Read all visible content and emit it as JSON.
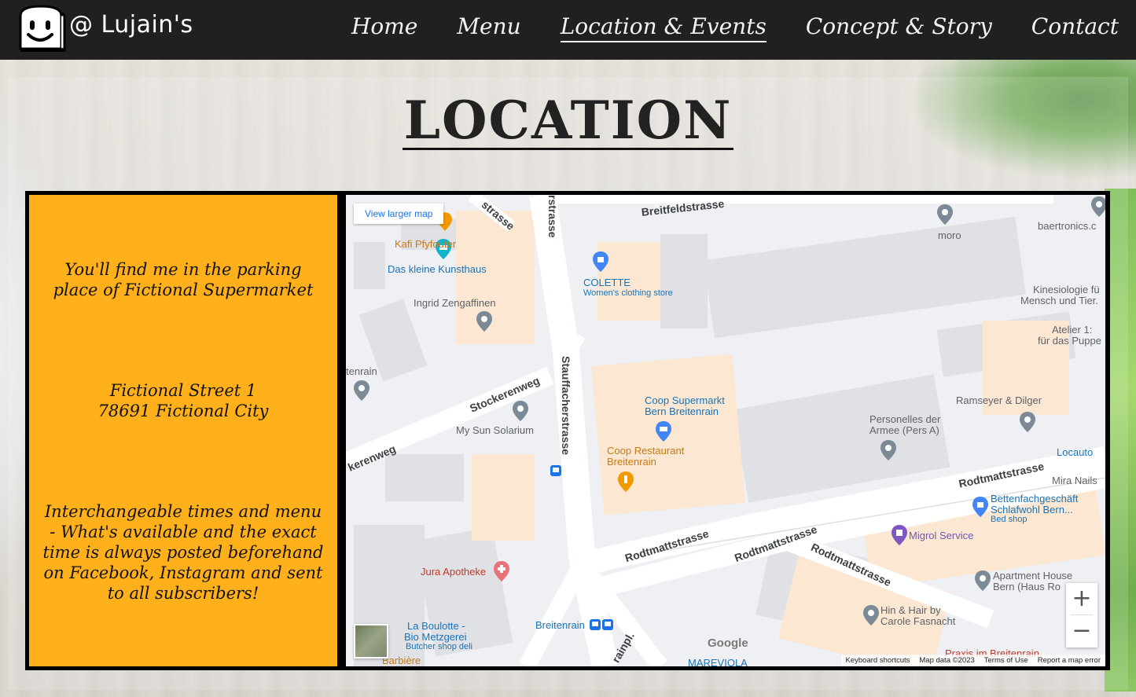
{
  "brand": {
    "name": "@ Lujain's"
  },
  "nav": {
    "items": [
      "Home",
      "Menu",
      "Location & Events",
      "Concept & Story",
      "Contact"
    ],
    "active": "Location & Events"
  },
  "heading": "LOCATION",
  "info": {
    "p1": "You'll find me in the parking place of Fictional Supermarket",
    "p2_line1": "Fictional Street 1",
    "p2_line2": "78691 Fictional City",
    "p3": "Interchangeable times and menu - What's available and the exact time is always posted beforehand on Facebook, Instagram and sent to all subscribers!"
  },
  "map": {
    "view_larger": "View larger map",
    "zoom_in": "+",
    "zoom_out": "−",
    "google": "Google",
    "attribution": [
      "Keyboard shortcuts",
      "Map data ©2023",
      "Terms of Use",
      "Report a map error"
    ],
    "streets": [
      "Breitfeldstrasse",
      "rstrasse",
      "strasse",
      "Stauffacherstrasse",
      "Stockerenweg",
      "kerenweg",
      "Rodtmattstrasse",
      "Rodtmattstrasse",
      "Rodtmattstrasse",
      "Rodtmattstrasse",
      "rainpl."
    ],
    "places": {
      "kafi": "Kafi Pfyfouter",
      "kunsthaus": "Das kleine Kunsthaus",
      "ingrid": "Ingrid Zengaffinen",
      "colette": "COLETTE",
      "colette_sub": "Women's clothing store",
      "moro": "moro",
      "baertronics": "baertronics.c",
      "kinesiologie1": "Kinesiologie fü",
      "kinesiologie2": "Mensch und Tier.",
      "atelier1": "Atelier 1:",
      "atelier2": "für das Puppe",
      "tenrain": "tenrain",
      "sunsolarium": "My Sun Solarium",
      "coop1": "Coop Supermarkt",
      "coop2": "Bern Breitenrain",
      "coopresto1": "Coop Restaurant",
      "coopresto2": "Breitenrain",
      "ramseyer": "Ramseyer & Dilger",
      "personelles1": "Personelles der",
      "personelles2": "Armee (Pers A)",
      "locauto": "Locauto",
      "miranails": "Mira Nails",
      "betten1": "Bettenfachgeschäft",
      "betten2": "Schlafwohl Bern...",
      "betten_sub": "Bed shop",
      "migrol": "Migrol Service",
      "apartment1": "Apartment House",
      "apartment2": "Bern (Haus Ro",
      "hinhair1": "Hin & Hair by",
      "hinhair2": "Carole Fasnacht",
      "jura": "Jura Apotheke",
      "boulotte1": "La Boulotte -",
      "boulotte2": "Bio Metzgerei",
      "boulotte_sub": "Butcher shop deli",
      "barbiere": "Barbière",
      "breitenrain_stop": "Breitenrain",
      "praxis": "Praxis im Breitenrain",
      "mareviola": "MAREVIOLA"
    }
  },
  "colors": {
    "accent": "#ffb01a",
    "navbar": "#202020"
  }
}
